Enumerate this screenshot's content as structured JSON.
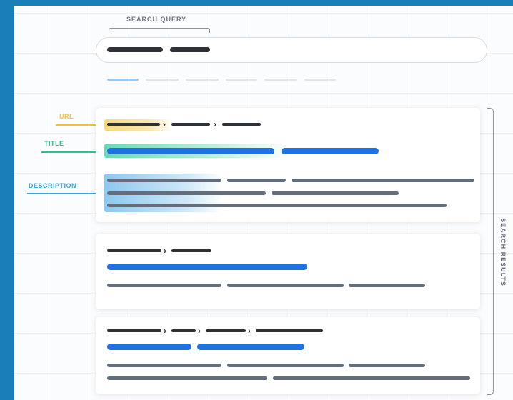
{
  "search": {
    "label": "SEARCH QUERY"
  },
  "annotations": {
    "url": {
      "label": "URL",
      "color": "#f2c230"
    },
    "title": {
      "label": "TITLE",
      "color": "#2bbf8f"
    },
    "description": {
      "label": "DESCRIPTION",
      "color": "#35a6e6"
    }
  },
  "results_label": "SEARCH RESULTS",
  "breadcrumb_separator": "›",
  "colors": {
    "background": "#1a7fb9",
    "title_blue": "#1f72e0",
    "url_dark": "#2e3136",
    "description_grey": "#646d7c"
  }
}
